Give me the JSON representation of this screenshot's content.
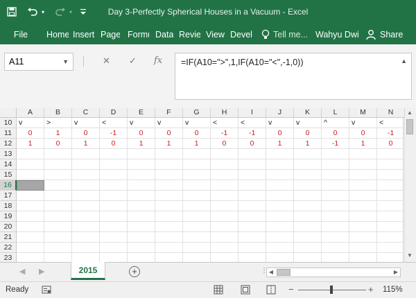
{
  "titlebar": {
    "title": "Day 3-Perfectly Spherical Houses in a Vacuum - Excel",
    "bg": "#217346"
  },
  "ribbon": {
    "file": "File",
    "tabs": [
      "Home",
      "Insert",
      "Page",
      "Formu",
      "Data",
      "Review",
      "View",
      "Devel"
    ],
    "tell_me": "Tell me...",
    "user": "Wahyu Dwi",
    "share": "Share"
  },
  "formula_bar": {
    "name_box": "A11",
    "formula": "=IF(A10=\">\",1,IF(A10=\"<\",-1,0))"
  },
  "sheet": {
    "columns": [
      "A",
      "B",
      "C",
      "D",
      "E",
      "F",
      "G",
      "H",
      "I",
      "J",
      "K",
      "L",
      "M",
      "N"
    ],
    "rows": [
      10,
      11,
      12,
      13,
      14,
      15,
      16,
      17,
      18,
      19,
      20,
      21,
      22,
      23
    ],
    "selected_row": 16,
    "selected_col": "A",
    "data": {
      "10": [
        "v",
        ">",
        "v",
        "<",
        "v",
        "v",
        "v",
        "<",
        "<",
        "v",
        "v",
        "^",
        "v",
        "<"
      ],
      "11": [
        "0",
        "1",
        "0",
        "-1",
        "0",
        "0",
        "0",
        "-1",
        "-1",
        "0",
        "0",
        "0",
        "0",
        "-1"
      ],
      "12": [
        "1",
        "0",
        "1",
        "0",
        "1",
        "1",
        "1",
        "0",
        "0",
        "1",
        "1",
        "-1",
        "1",
        "0"
      ]
    }
  },
  "tabs": {
    "sheet_name": "2015",
    "accent": "#217346"
  },
  "status": {
    "ready": "Ready",
    "zoom": "115%"
  }
}
